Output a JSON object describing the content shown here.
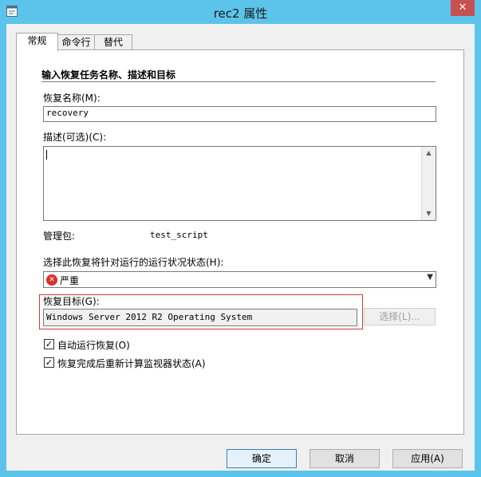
{
  "window": {
    "title": "rec2 属性",
    "close_glyph": "✕"
  },
  "tabs": [
    {
      "label": "常规",
      "active": true
    },
    {
      "label": "命令行",
      "active": false
    },
    {
      "label": "替代",
      "active": false
    }
  ],
  "general": {
    "section_title": "输入恢复任务名称、描述和目标",
    "name_label": "恢复名称(M):",
    "name_value": "recovery",
    "description_label": "描述(可选)(C):",
    "description_value": "",
    "management_pack_label": "管理包:",
    "management_pack_value": "test_script",
    "health_state_label": "选择此恢复将针对运行的运行状况状态(H):",
    "health_state_value": "严重",
    "health_state_icon": "critical-error-icon",
    "target_label": "恢复目标(G):",
    "target_value": "Windows Server 2012 R2 Operating System",
    "select_button": "选择(L)...",
    "auto_run_label": "自动运行恢复(O)",
    "auto_run_checked": true,
    "recalc_label": "恢复完成后重新计算监视器状态(A)",
    "recalc_checked": true
  },
  "footer": {
    "ok": "确定",
    "cancel": "取消",
    "apply": "应用(A)"
  },
  "colors": {
    "window_frame": "#5cc4ea",
    "close_button": "#c75050",
    "highlight_border": "#d23a3a",
    "critical": "#d9322b"
  }
}
